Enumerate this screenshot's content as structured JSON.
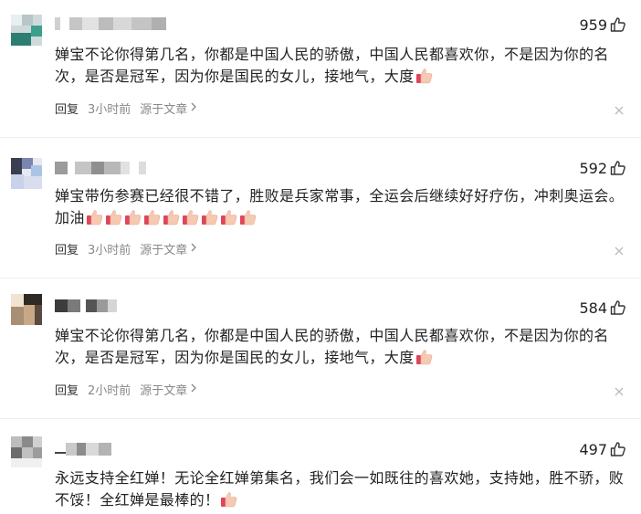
{
  "comments": [
    {
      "likes": "959",
      "text": "婵宝不论你得第几名，你都是中国人民的骄傲，中国人民都喜欢你，不是因为你的名次，是否是冠军，因为你是国民的女儿，接地气，大度",
      "emoji_count": 1,
      "reply": "回复",
      "time": "3小时前",
      "source": "源于文章"
    },
    {
      "likes": "592",
      "text": "婵宝带伤参赛已经很不错了，胜败是兵家常事，全运会后继续好好疗伤，冲刺奥运会。加油",
      "emoji_count": 9,
      "reply": "回复",
      "time": "3小时前",
      "source": "源于文章"
    },
    {
      "likes": "584",
      "text": "婵宝不论你得第几名，你都是中国人民的骄傲，中国人民都喜欢你，不是因为你的名次，是否是冠军，因为你是国民的女儿，接地气，大度",
      "emoji_count": 1,
      "reply": "回复",
      "time": "2小时前",
      "source": "源于文章"
    },
    {
      "likes": "497",
      "text": "永远支持全红婵！无论全红婵第集名，我们会一如既往的喜欢她，支持她，胜不骄，败不馁！全红婵是最棒的！",
      "emoji_count": 1,
      "reply": "回复",
      "time": "",
      "source": ""
    }
  ],
  "icons": {
    "like": "thumbs-up-outline-icon",
    "emoji": "thumbs-up-emoji-icon",
    "close": "close-x-icon",
    "chevron": "chevron-right-icon"
  },
  "colors": {
    "text": "#222222",
    "meta": "#888888",
    "emoji_skin": "#f6c9b3",
    "emoji_cuff": "#e0455a"
  }
}
